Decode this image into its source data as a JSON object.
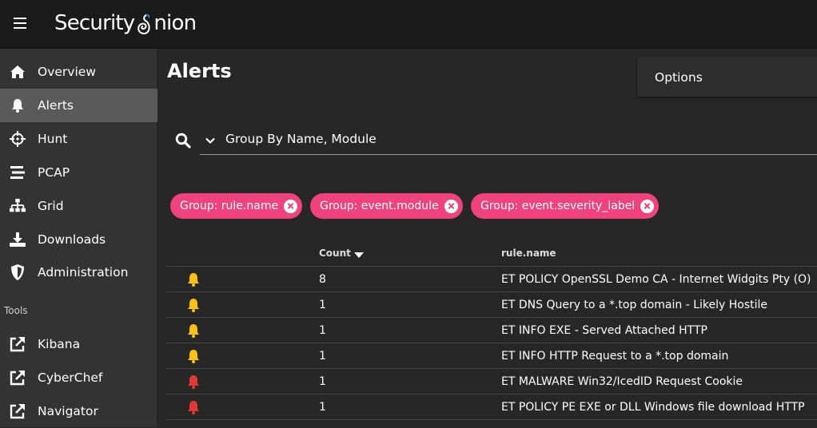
{
  "app": {
    "brand": "SecurityOnion"
  },
  "nav": {
    "items": [
      {
        "label": "Overview",
        "icon": "home-icon"
      },
      {
        "label": "Alerts",
        "icon": "bell-icon",
        "active": true
      },
      {
        "label": "Hunt",
        "icon": "crosshairs-icon"
      },
      {
        "label": "PCAP",
        "icon": "stream-icon"
      },
      {
        "label": "Grid",
        "icon": "sitemap-icon"
      },
      {
        "label": "Downloads",
        "icon": "download-icon"
      },
      {
        "label": "Administration",
        "icon": "shield-icon"
      }
    ],
    "tools_heading": "Tools",
    "tools": [
      {
        "label": "Kibana",
        "icon": "external-link-icon"
      },
      {
        "label": "CyberChef",
        "icon": "external-link-icon"
      },
      {
        "label": "Navigator",
        "icon": "external-link-icon"
      }
    ]
  },
  "page": {
    "title": "Alerts",
    "options_label": "Options"
  },
  "query": {
    "value": "Group By Name, Module"
  },
  "chips": [
    "Group: rule.name",
    "Group: event.module",
    "Group: event.severity_label"
  ],
  "table": {
    "headers": {
      "count": "Count",
      "rule": "rule.name"
    },
    "rows": [
      {
        "severity": "medium",
        "count": "8",
        "rule": "ET POLICY OpenSSL Demo CA - Internet Widgits Pty (O)"
      },
      {
        "severity": "medium",
        "count": "1",
        "rule": "ET DNS Query to a *.top domain - Likely Hostile"
      },
      {
        "severity": "medium",
        "count": "1",
        "rule": "ET INFO EXE - Served Attached HTTP"
      },
      {
        "severity": "medium",
        "count": "1",
        "rule": "ET INFO HTTP Request to a *.top domain"
      },
      {
        "severity": "high",
        "count": "1",
        "rule": "ET MALWARE Win32/IcedID Request Cookie"
      },
      {
        "severity": "high",
        "count": "1",
        "rule": "ET POLICY PE EXE or DLL Windows file download HTTP"
      }
    ]
  },
  "colors": {
    "accent": "#f0427c",
    "medium": "#f9c110",
    "high": "#e53935"
  }
}
